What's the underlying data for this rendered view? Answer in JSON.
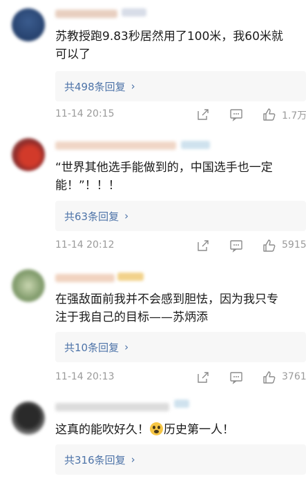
{
  "comments": [
    {
      "avatar_color": "#2c4a7a",
      "text_lines": [
        "苏教授跑9.83秒居然用了100米，我60米就",
        "可以了"
      ],
      "reply_label": "共498条回复",
      "time": "11-14 20:15",
      "likes": "1.7万"
    },
    {
      "avatar_color": "#c4392b",
      "text_lines": [
        "“世界其他选手能做到的，中国选手也一定",
        "能！”！！！"
      ],
      "reply_label": "共63条回复",
      "time": "11-14 20:12",
      "likes": "5915"
    },
    {
      "avatar_color": "#9cae7a",
      "text_lines": [
        "在强敌面前我并不会感到胆怯，因为我只专",
        "注于我自己的目标——苏炳添"
      ],
      "reply_label": "共10条回复",
      "time": "11-14 20:13",
      "likes": "3761"
    },
    {
      "avatar_color": "#3a3a3a",
      "text_before_emoji": "这真的能吹好久！",
      "emoji_icon": "astonished-face-emoji",
      "text_after_emoji": "历史第一人！",
      "reply_label": "共316条回复"
    }
  ],
  "icons": {
    "share": "share-icon",
    "comment": "comment-icon",
    "like": "thumbs-up-icon",
    "chevron": "chevron-right-icon",
    "chevron_glyph": "›"
  }
}
